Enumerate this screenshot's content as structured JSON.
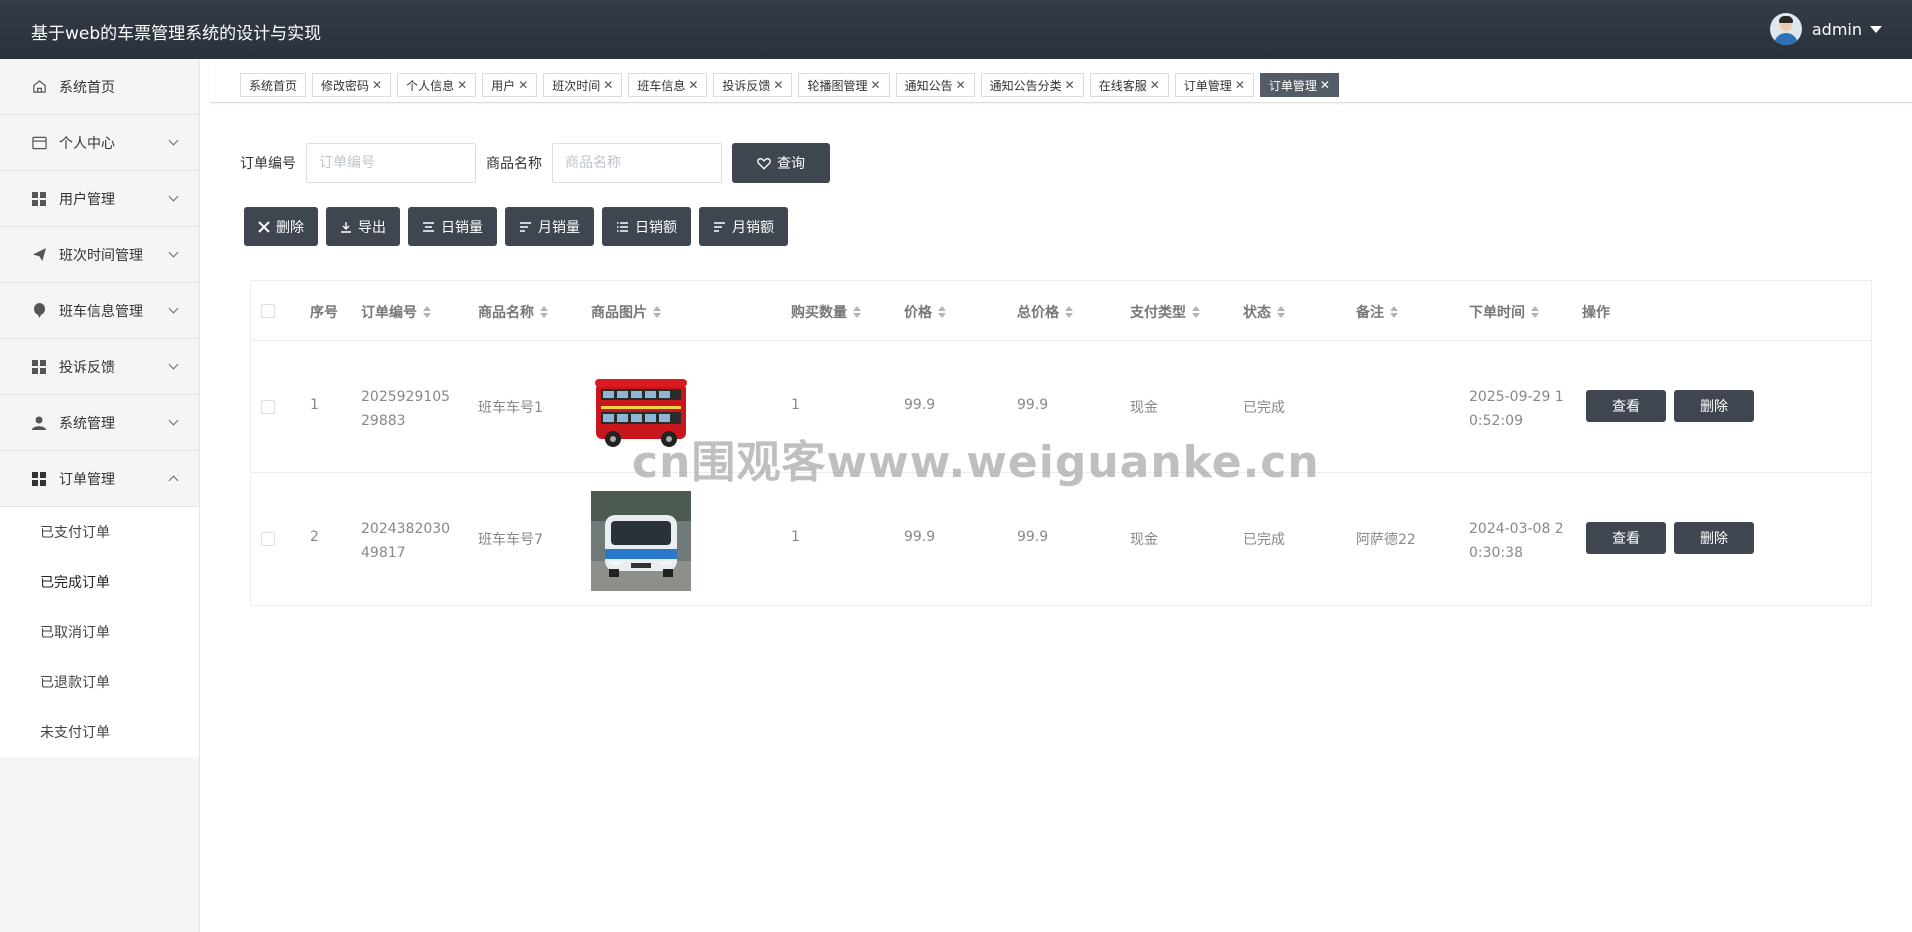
{
  "header": {
    "app_title": "基于web的车票管理系统的设计与实现",
    "user_name": "admin"
  },
  "sidebar": {
    "items": [
      {
        "label": "系统首页",
        "icon": "home-icon"
      },
      {
        "label": "个人中心",
        "icon": "card-icon"
      },
      {
        "label": "用户管理",
        "icon": "grid-icon"
      },
      {
        "label": "班次时间管理",
        "icon": "send-icon"
      },
      {
        "label": "班车信息管理",
        "icon": "balloon-icon"
      },
      {
        "label": "投诉反馈",
        "icon": "grid-icon"
      },
      {
        "label": "系统管理",
        "icon": "user-icon"
      },
      {
        "label": "订单管理",
        "icon": "grid-icon"
      }
    ],
    "submenu": [
      "已支付订单",
      "已完成订单",
      "已取消订单",
      "已退款订单",
      "未支付订单"
    ]
  },
  "tabs": [
    "系统首页",
    "修改密码",
    "个人信息",
    "用户",
    "班次时间",
    "班车信息",
    "投诉反馈",
    "轮播图管理",
    "通知公告",
    "通知公告分类",
    "在线客服",
    "订单管理",
    "订单管理"
  ],
  "search": {
    "order_no_label": "订单编号",
    "order_no_placeholder": "订单编号",
    "product_name_label": "商品名称",
    "product_name_placeholder": "商品名称",
    "query_label": "查询"
  },
  "actions": {
    "delete": "删除",
    "export": "导出",
    "daily_sales_qty": "日销量",
    "monthly_sales_qty": "月销量",
    "daily_sales_amount": "日销额",
    "monthly_sales_amount": "月销额"
  },
  "table": {
    "columns": [
      "序号",
      "订单编号",
      "商品名称",
      "商品图片",
      "购买数量",
      "价格",
      "总价格",
      "支付类型",
      "状态",
      "备注",
      "下单时间",
      "操作"
    ],
    "rows": [
      {
        "index": "1",
        "order_no": "202592910529883",
        "product_name": "班车车号1",
        "image": "red-double-decker-bus",
        "qty": "1",
        "price": "99.9",
        "total": "99.9",
        "pay_type": "现金",
        "status": "已完成",
        "remark": "",
        "time": "2025-09-29 10:52:09"
      },
      {
        "index": "2",
        "order_no": "202438203049817",
        "product_name": "班车车号7",
        "image": "blue-white-bus",
        "qty": "1",
        "price": "99.9",
        "total": "99.9",
        "pay_type": "现金",
        "status": "已完成",
        "remark": "阿萨德22",
        "time": "2024-03-08 20:30:38"
      }
    ],
    "view_label": "查看",
    "delete_label": "删除"
  },
  "watermark": "cn围观客www.weiguanke.cn",
  "colors": {
    "header_bg": "#2f3640",
    "button_dark": "#3f4650",
    "active_tab": "#545c66"
  }
}
